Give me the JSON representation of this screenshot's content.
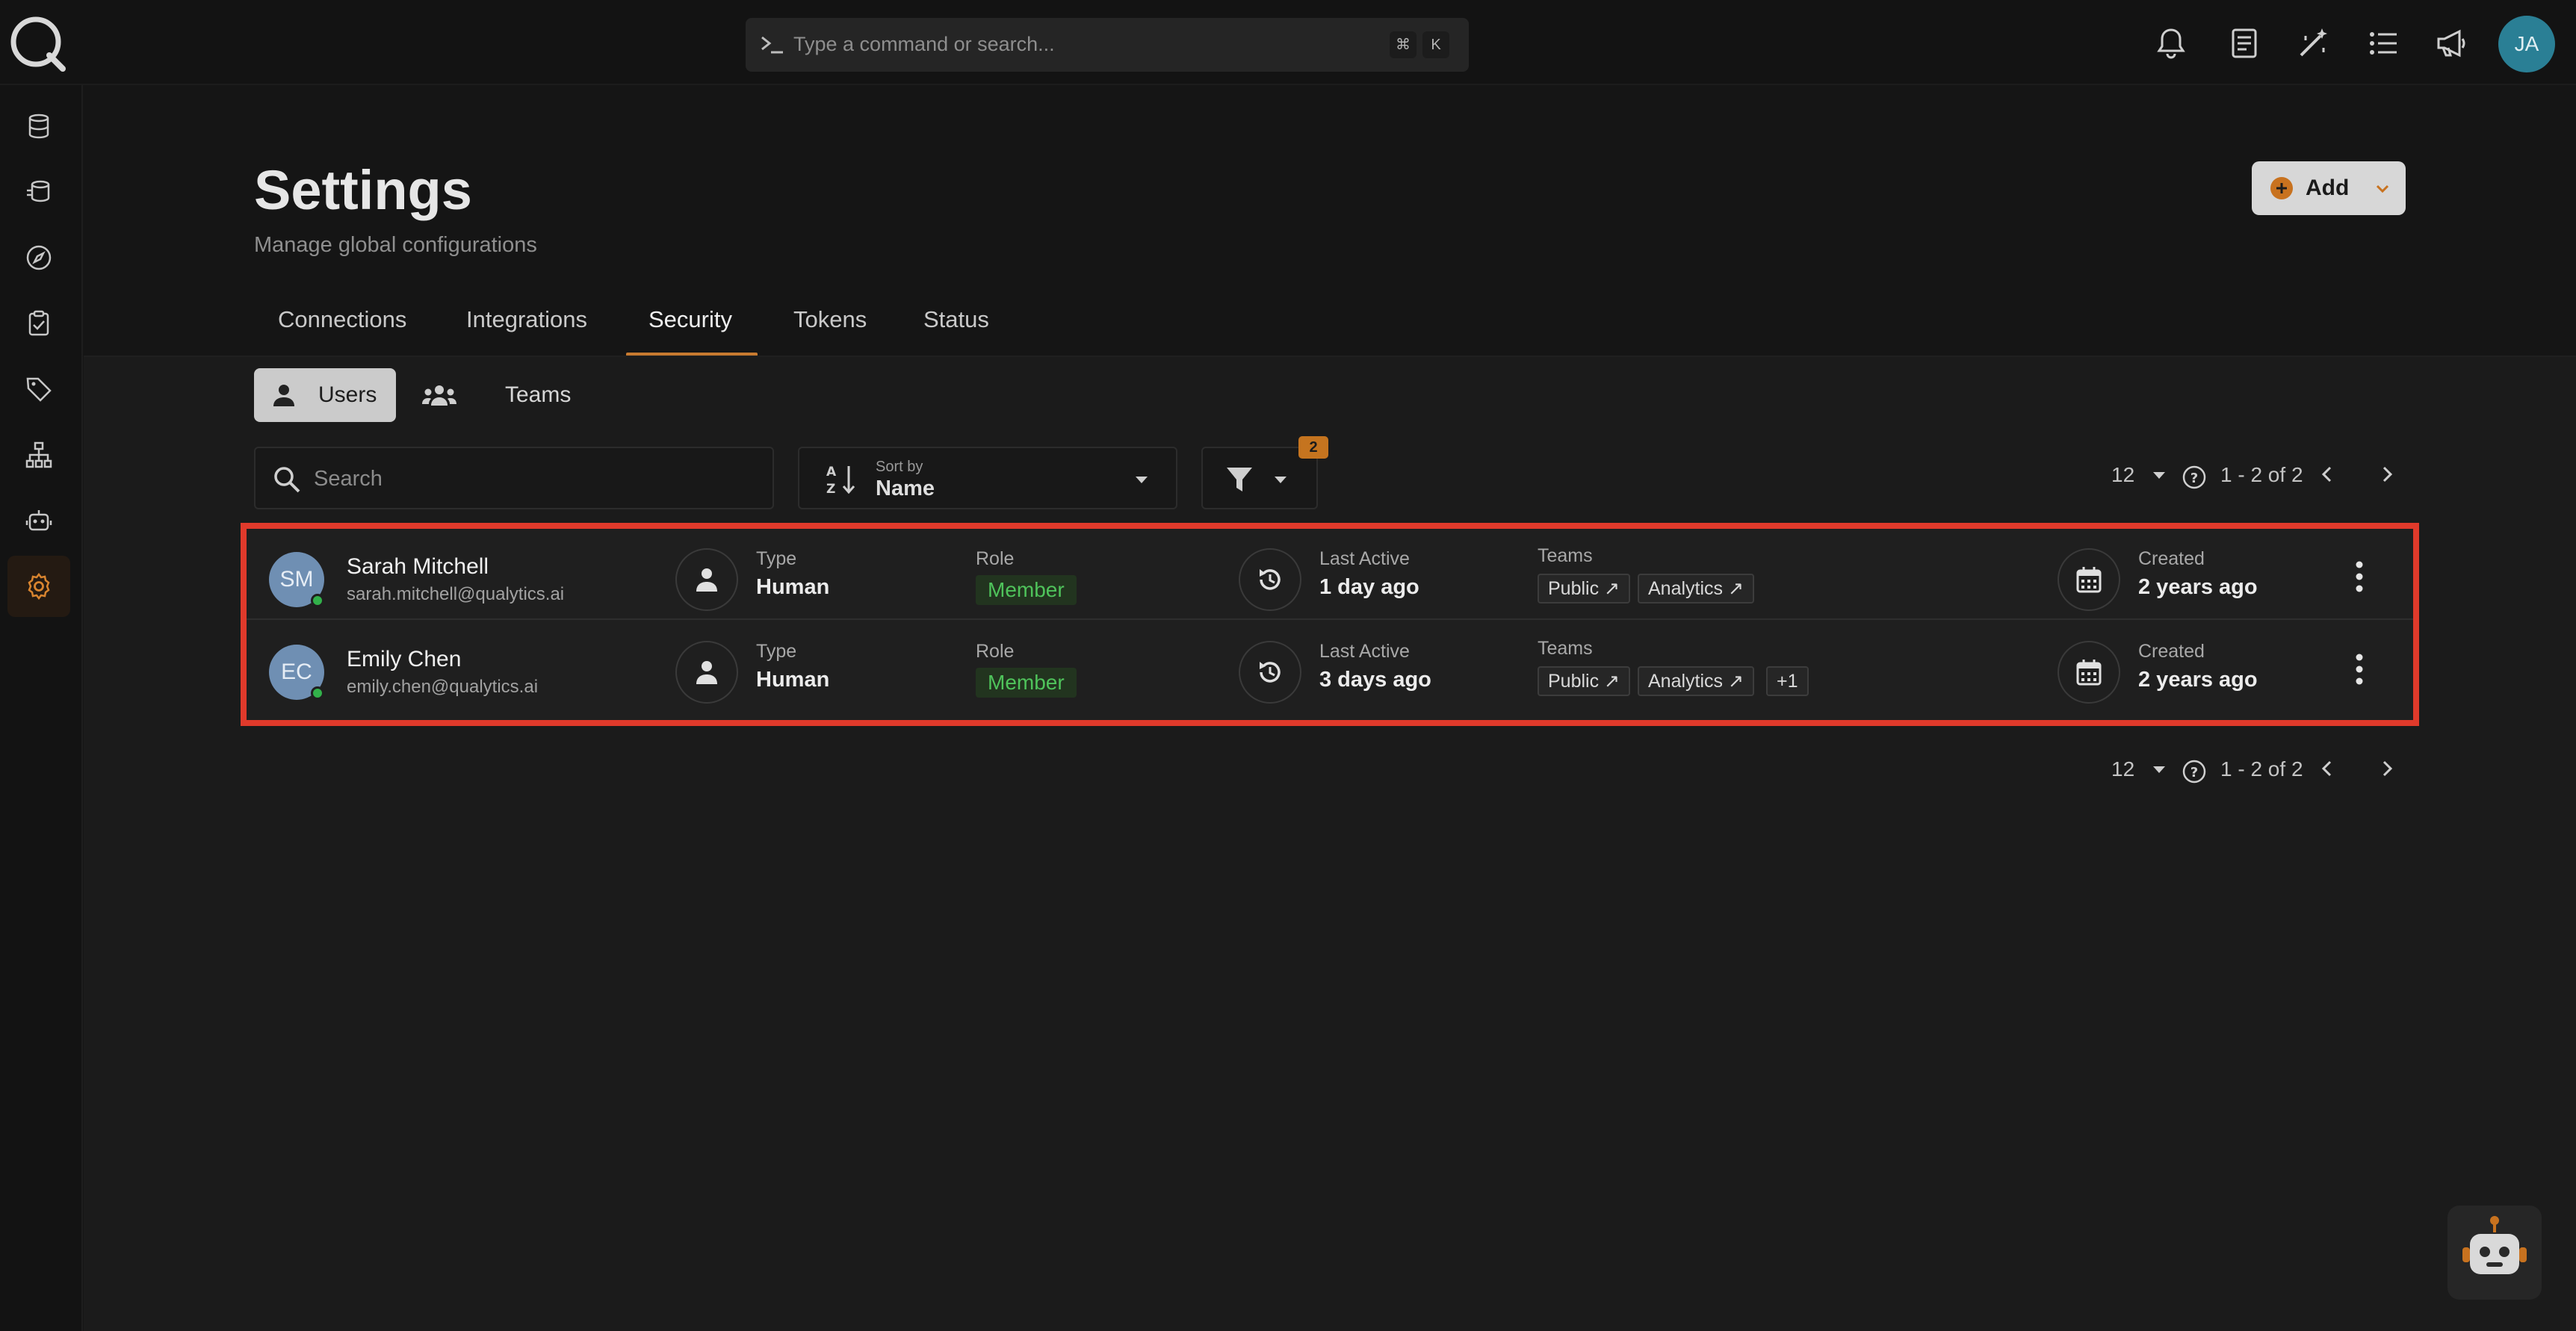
{
  "topbar": {
    "command_placeholder": "Type a command or search...",
    "shortcut_key_1": "⌘",
    "shortcut_key_2": "K",
    "user_initials": "JA"
  },
  "page": {
    "title": "Settings",
    "subtitle": "Manage global configurations",
    "add_label": "Add"
  },
  "tabs": [
    "Connections",
    "Integrations",
    "Security",
    "Tokens",
    "Status"
  ],
  "active_tab": "Security",
  "segments": {
    "users": "Users",
    "teams": "Teams"
  },
  "toolbar": {
    "search_placeholder": "Search",
    "sort_caption": "Sort by",
    "sort_value": "Name",
    "filter_count": "2"
  },
  "pagination": {
    "page_size": "12",
    "range": "1 - 2 of 2"
  },
  "labels": {
    "type": "Type",
    "role": "Role",
    "last_active": "Last Active",
    "teams": "Teams",
    "created": "Created"
  },
  "users": [
    {
      "initials": "SM",
      "name": "Sarah Mitchell",
      "email": "sarah.mitchell@qualytics.ai",
      "type": "Human",
      "role": "Member",
      "last_active": "1 day ago",
      "teams": [
        "Public ↗",
        "Analytics ↗"
      ],
      "created": "2 years ago"
    },
    {
      "initials": "EC",
      "name": "Emily Chen",
      "email": "emily.chen@qualytics.ai",
      "type": "Human",
      "role": "Member",
      "last_active": "3 days ago",
      "teams": [
        "Public ↗",
        "Analytics ↗",
        "+1"
      ],
      "created": "2 years ago"
    }
  ],
  "colors": {
    "accent": "#c87a30",
    "highlight_border": "#e03a2b",
    "role_text": "#4fc35b",
    "avatar_bg": "#6f8fb3"
  }
}
